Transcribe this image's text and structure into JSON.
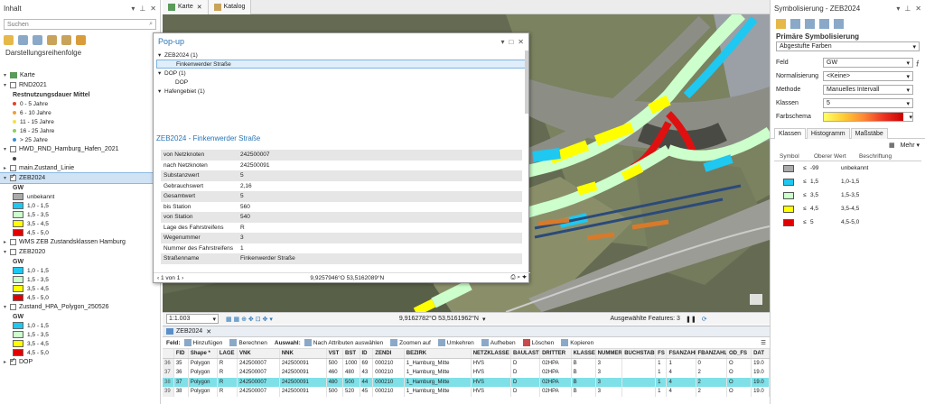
{
  "left": {
    "title": "Inhalt",
    "search_placeholder": "Suchen",
    "section": "Darstellungsreihenfolge",
    "map_item": "Karte",
    "layers": [
      {
        "name": "RND2021",
        "checked": false
      },
      {
        "name": "HWD_RND_Hamburg_Hafen_2021",
        "checked": false
      },
      {
        "name": "main.Zustand_Linie",
        "checked": false
      },
      {
        "name": "ZEB2024",
        "checked": true
      },
      {
        "name": "WMS ZEB Zustandsklassen Hamburg",
        "checked": false
      },
      {
        "name": "ZEB2020",
        "checked": false
      },
      {
        "name": "Zustand_HPA_Polygon_250526",
        "checked": false
      },
      {
        "name": "DOP",
        "checked": true
      }
    ],
    "rnd_legend_title": "Restnutzungsdauer Mittel",
    "rnd_legend": [
      {
        "label": "0 - 5 Jahre",
        "color": "#e0442a"
      },
      {
        "label": "6 - 10 Jahre",
        "color": "#f0a030"
      },
      {
        "label": "11 - 15 Jahre",
        "color": "#f5e04a"
      },
      {
        "label": "16 - 25 Jahre",
        "color": "#8fcf5a"
      },
      {
        "label": "> 25 Jahre",
        "color": "#3a8fd0"
      }
    ],
    "gw_label": "GW",
    "zeb2024_legend": [
      {
        "label": "unbekannt",
        "color": "#aaaaaa"
      },
      {
        "label": "1,0 - 1,5",
        "color": "#1ec8f0"
      },
      {
        "label": "1,5 - 3,5",
        "color": "#ccffcc"
      },
      {
        "label": "3,5 - 4,5",
        "color": "#ffff00"
      },
      {
        "label": "4,5 - 5,0",
        "color": "#e00000"
      }
    ],
    "zeb2020_legend": [
      {
        "label": "1,0 - 1,5",
        "color": "#1ec8f0"
      },
      {
        "label": "1,5 - 3,5",
        "color": "#ccffcc"
      },
      {
        "label": "3,5 - 4,5",
        "color": "#ffff00"
      },
      {
        "label": "4,5 - 5,0",
        "color": "#e00000"
      }
    ],
    "hpa_legend": [
      {
        "label": "1,0 - 1,5",
        "color": "#1ec8f0"
      },
      {
        "label": "1,5 - 3,5",
        "color": "#ccffcc"
      },
      {
        "label": "3,5 - 4,5",
        "color": "#ffff00"
      },
      {
        "label": "4,5 - 5,0",
        "color": "#e00000"
      }
    ]
  },
  "tabs": [
    {
      "label": "Karte"
    },
    {
      "label": "Katalog"
    }
  ],
  "popup": {
    "title": "Pop-up",
    "list": [
      {
        "label": "ZEB2024 (1)",
        "indent": 0,
        "selected": false
      },
      {
        "label": "Finkenwerder Straße",
        "indent": 1,
        "selected": true
      },
      {
        "label": "DOP (1)",
        "indent": 0,
        "selected": false
      },
      {
        "label": "DOP",
        "indent": 1,
        "selected": false
      },
      {
        "label": "Hafengebiet (1)",
        "indent": 0,
        "selected": false
      }
    ],
    "subtitle": "ZEB2024 - Finkenwerder Straße",
    "rows": [
      {
        "k": "von Netzknoten",
        "v": "242500007"
      },
      {
        "k": "nach Netzknoten",
        "v": "242500091"
      },
      {
        "k": "Substanzwert",
        "v": "5"
      },
      {
        "k": "Gebrauchswert",
        "v": "2,16"
      },
      {
        "k": "Gesamtwert",
        "v": "5"
      },
      {
        "k": "bis Station",
        "v": "560"
      },
      {
        "k": "von Station",
        "v": "540"
      },
      {
        "k": "Lage des Fahrstreifens",
        "v": "R"
      },
      {
        "k": "Wegenummer",
        "v": "3"
      },
      {
        "k": "Nummer des Fahrstreifens",
        "v": "1"
      },
      {
        "k": "Straßenname",
        "v": "Finkenwerder Straße"
      }
    ],
    "paging": "1 von 1",
    "coords": "9,9257946°O 53,5162089°N"
  },
  "mapstatus": {
    "scale": "1:1.003",
    "coords": "9,9162782°O 53,5161962°N",
    "selected": "Ausgewählte Features: 3"
  },
  "attr": {
    "tab": "ZEB2024",
    "field_label": "Feld:",
    "field_buttons": [
      "Hinzufügen",
      "Berechnen"
    ],
    "sel_label": "Auswahl:",
    "sel_buttons": [
      "Nach Attributen auswählen",
      "Zoomen auf",
      "Umkehren",
      "Aufheben",
      "Löschen",
      "Kopieren"
    ],
    "columns": [
      "",
      "FID",
      "Shape *",
      "LAGE",
      "VNK",
      "NNK",
      "VST",
      "BST",
      "ID",
      "ZENDI",
      "BEZIRK",
      "NETZKLASSE",
      "BAULAST",
      "DRITTER",
      "KLASSE",
      "NUMMER",
      "BUCHSTABE",
      "FS",
      "FSANZAHL",
      "FBANZAHL",
      "OD_FS",
      "DAT"
    ],
    "rows": [
      {
        "hl": false,
        "cells": [
          "36",
          "35",
          "Polygon",
          "R",
          "242500007",
          "242500091",
          "500",
          "1000",
          "69",
          "000210",
          "1_Hamburg_Mitte",
          "HVS",
          "D",
          "02HPA",
          "B",
          "3",
          "",
          "1",
          "1",
          "0",
          "O",
          "19.0"
        ]
      },
      {
        "hl": false,
        "cells": [
          "37",
          "36",
          "Polygon",
          "R",
          "242500007",
          "242500091",
          "460",
          "480",
          "43",
          "000210",
          "1_Hamburg_Mitte",
          "HVS",
          "D",
          "02HPA",
          "B",
          "3",
          "",
          "1",
          "4",
          "2",
          "O",
          "19.0"
        ]
      },
      {
        "hl": true,
        "cells": [
          "38",
          "37",
          "Polygon",
          "R",
          "242500007",
          "242500091",
          "480",
          "500",
          "44",
          "000210",
          "1_Hamburg_Mitte",
          "HVS",
          "D",
          "02HPA",
          "B",
          "3",
          "",
          "1",
          "4",
          "2",
          "O",
          "19.0"
        ]
      },
      {
        "hl": false,
        "cells": [
          "39",
          "38",
          "Polygon",
          "R",
          "242500007",
          "242500091",
          "500",
          "520",
          "45",
          "000210",
          "1_Hamburg_Mitte",
          "HVS",
          "D",
          "02HPA",
          "B",
          "3",
          "",
          "1",
          "4",
          "2",
          "O",
          "19.0"
        ]
      }
    ]
  },
  "right": {
    "title": "Symbolisierung - ZEB2024",
    "section": "Primäre Symbolisierung",
    "method_combo": "Abgestufte Farben",
    "fields": [
      {
        "k": "Feld",
        "v": "GW"
      },
      {
        "k": "Normalisierung",
        "v": "<Keine>"
      },
      {
        "k": "Methode",
        "v": "Manuelles Intervall"
      },
      {
        "k": "Klassen",
        "v": "5"
      },
      {
        "k": "Farbschema",
        "v": ""
      }
    ],
    "tabs": [
      "Klassen",
      "Histogramm",
      "Maßstäbe"
    ],
    "more": "Mehr",
    "class_headers": [
      "Symbol",
      "Oberer Wert",
      "Beschriftung"
    ],
    "classes": [
      {
        "color": "#aaaaaa",
        "le": "≤",
        "upper": "-99",
        "label": "unbekannt"
      },
      {
        "color": "#1ec8f0",
        "le": "≤",
        "upper": "1,5",
        "label": "1,0-1,5"
      },
      {
        "color": "#ccffcc",
        "le": "≤",
        "upper": "3,5",
        "label": "1,5-3,5"
      },
      {
        "color": "#ffff00",
        "le": "≤",
        "upper": "4,5",
        "label": "3,5-4,5"
      },
      {
        "color": "#e00000",
        "le": "≤",
        "upper": "5",
        "label": "4,5-5,0"
      }
    ]
  }
}
